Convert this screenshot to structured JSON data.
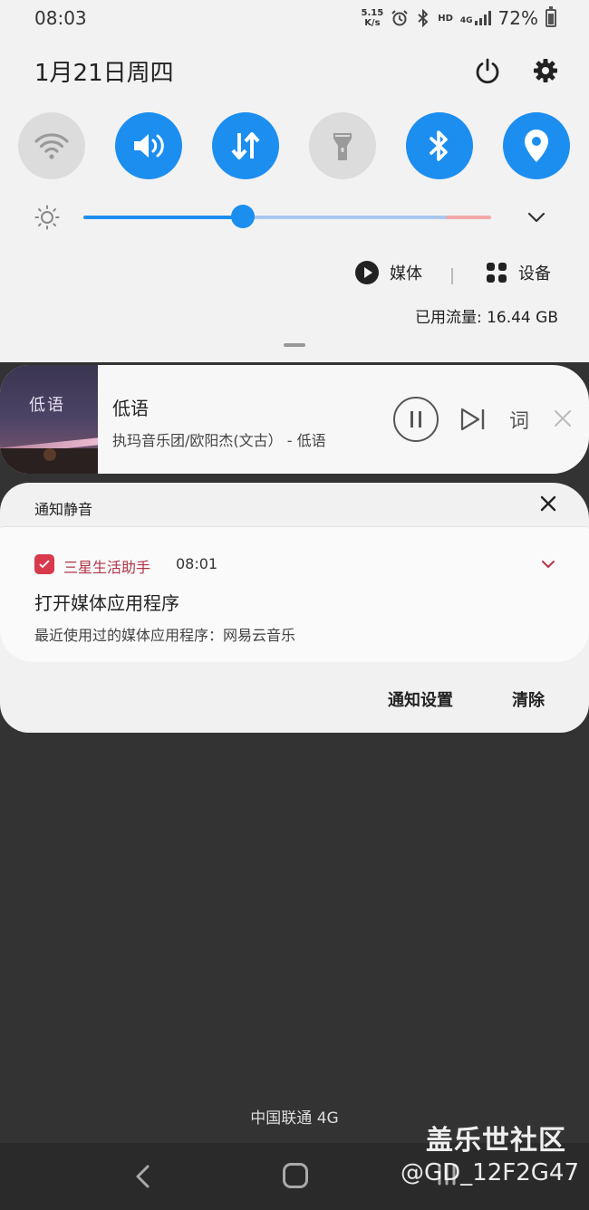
{
  "status_bar": {
    "time": "08:03",
    "net_speed_value": "5.15",
    "net_speed_unit": "K/s",
    "hd_label": "HD",
    "network_type": "4G",
    "battery_percent": "72%",
    "battery_level": 0.72
  },
  "header": {
    "date": "1月21日周四"
  },
  "quick_settings": {
    "toggles": [
      {
        "name": "wifi",
        "icon": "wifi-icon",
        "on": false
      },
      {
        "name": "sound",
        "icon": "volume-icon",
        "on": true
      },
      {
        "name": "mobile-data",
        "icon": "data-arrows-icon",
        "on": true
      },
      {
        "name": "flashlight",
        "icon": "flashlight-icon",
        "on": false
      },
      {
        "name": "bluetooth",
        "icon": "bluetooth-icon",
        "on": true
      },
      {
        "name": "location",
        "icon": "location-icon",
        "on": true
      }
    ],
    "brightness_level": 0.39
  },
  "media_controls": {
    "media_label": "媒体",
    "devices_label": "设备",
    "data_usage": "已用流量: 16.44 GB"
  },
  "music": {
    "title": "低语",
    "artist": "执玛音乐团/欧阳杰(文古） - 低语",
    "album_art_text": "低语",
    "lyrics_label": "词"
  },
  "notifications": {
    "group_title": "通知静音",
    "items": [
      {
        "app_name": "三星生活助手",
        "time": "08:01",
        "title": "打开媒体应用程序",
        "body": "最近使用过的媒体应用程序：网易云音乐"
      }
    ],
    "settings_label": "通知设置",
    "clear_label": "清除"
  },
  "carrier": "中国联通 4G",
  "watermark": {
    "site": "盖乐世社区",
    "user": "@GD_12F2G47"
  },
  "colors": {
    "accent": "#1c8ef0",
    "panel_bg": "#f2f2f2",
    "overlay_bg": "#333333",
    "app_red": "#d9394c"
  }
}
